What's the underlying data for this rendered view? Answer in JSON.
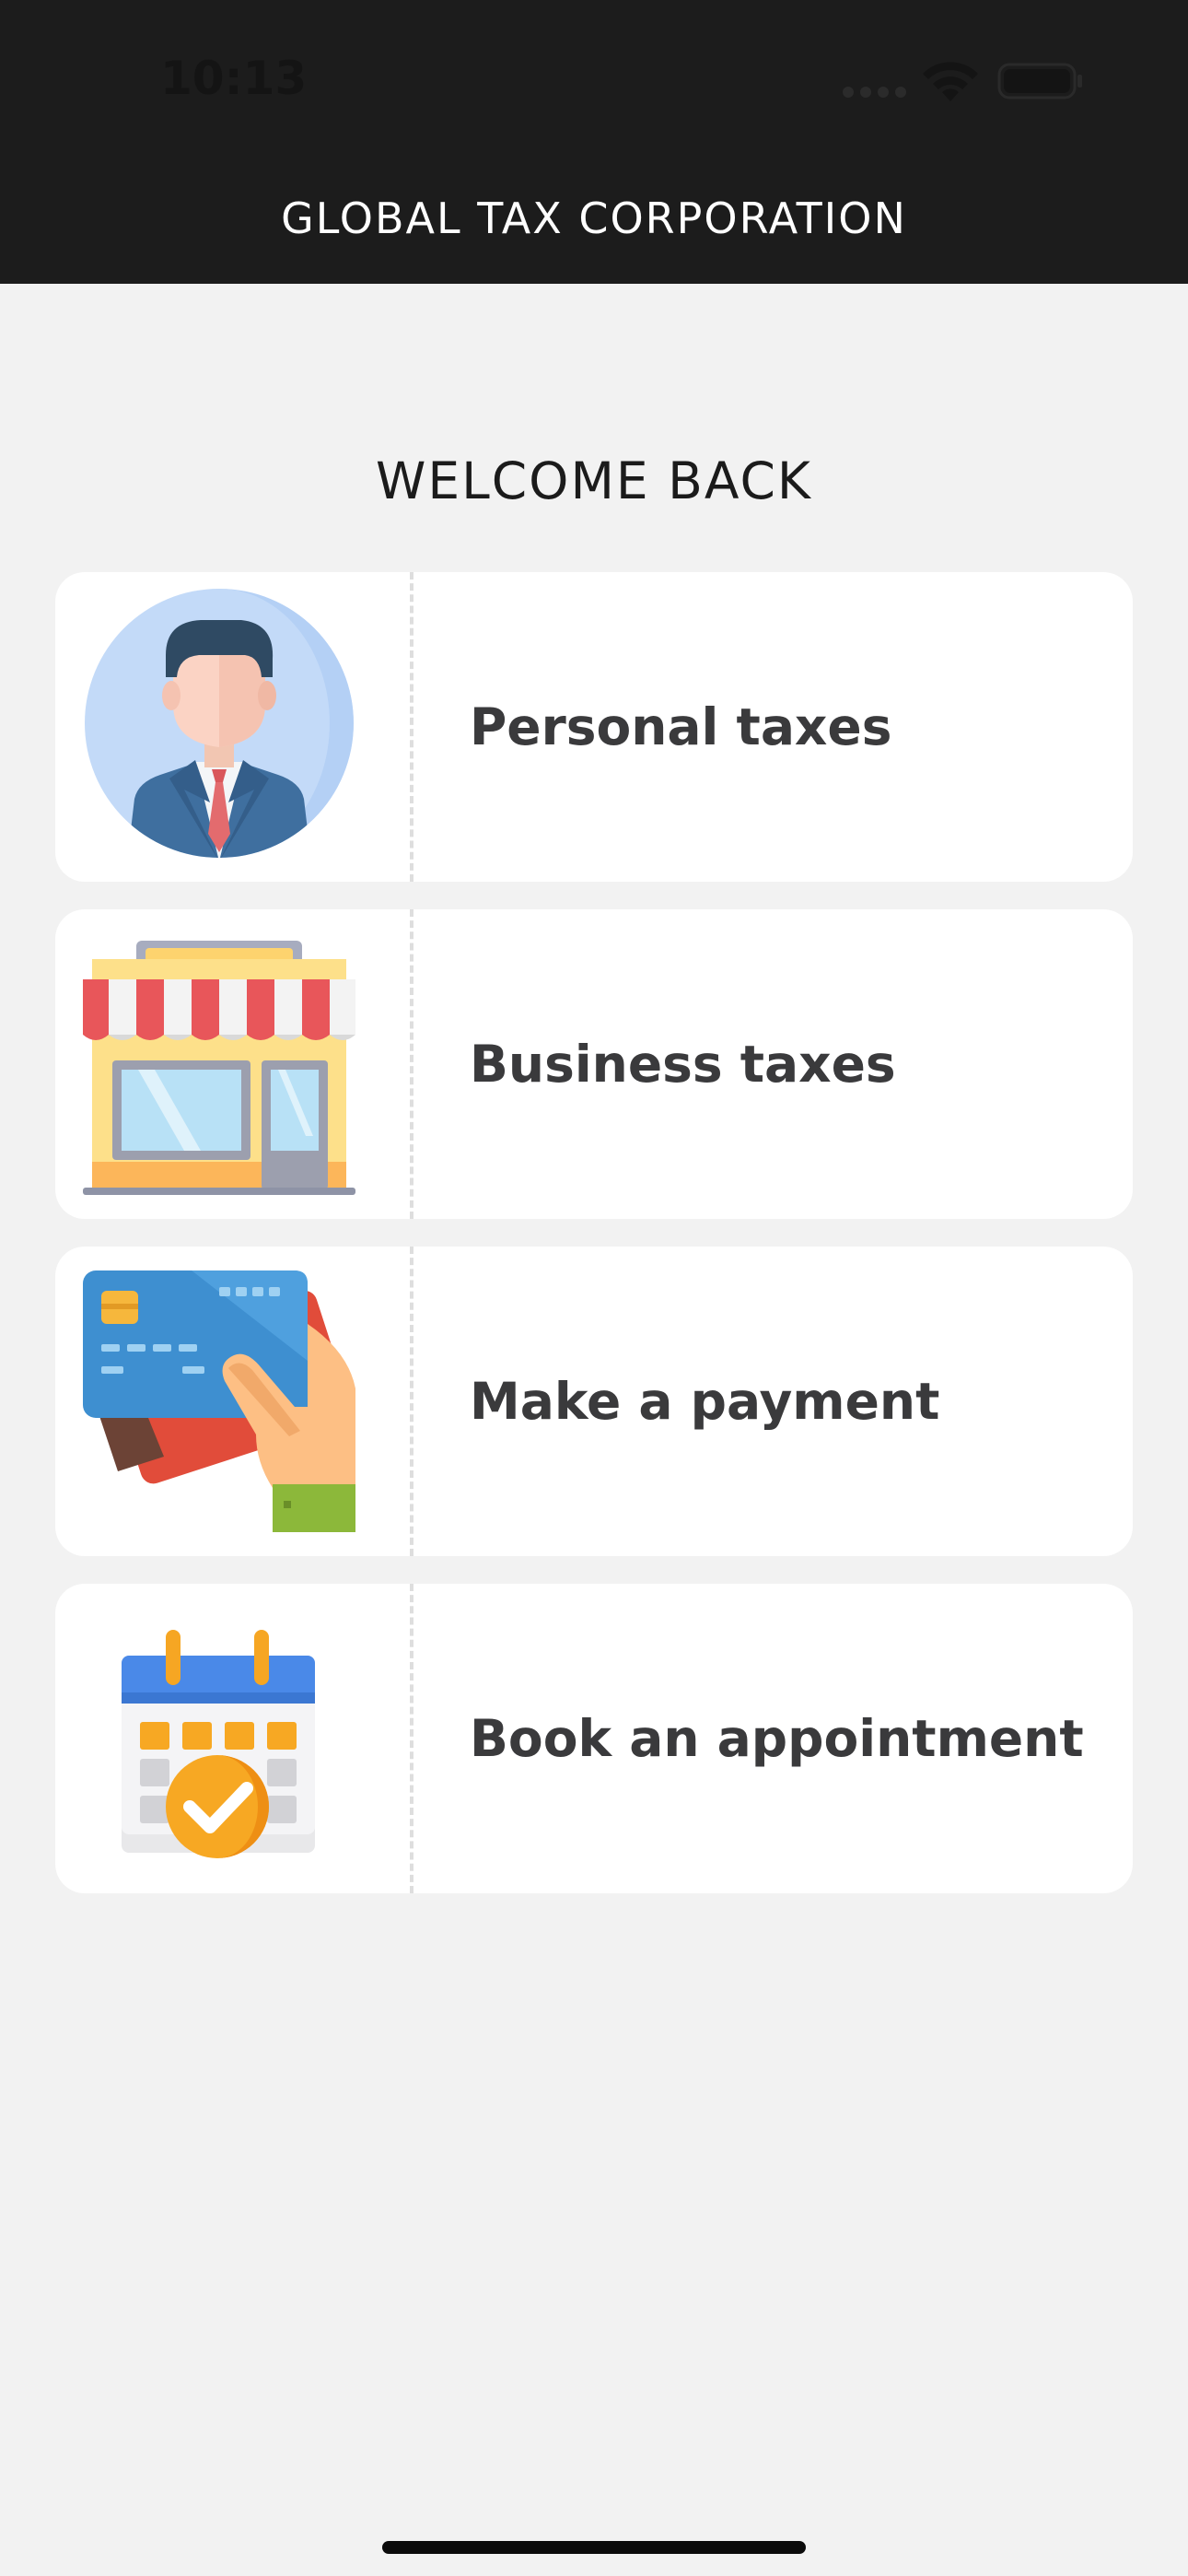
{
  "status_bar": {
    "time": "10:13"
  },
  "header": {
    "title": "GLOBAL TAX CORPORATION"
  },
  "main": {
    "welcome": "WELCOME BACK",
    "cards": [
      {
        "label": "Personal taxes",
        "icon": "businessman-icon"
      },
      {
        "label": "Business taxes",
        "icon": "storefront-icon"
      },
      {
        "label": "Make a payment",
        "icon": "credit-card-hand-icon"
      },
      {
        "label": "Book an appointment",
        "icon": "calendar-check-icon"
      }
    ]
  },
  "colors": {
    "header_bg": "#1c1c1c",
    "page_bg": "#f2f2f2",
    "card_bg": "#ffffff",
    "label_text": "#3a3a3c"
  }
}
